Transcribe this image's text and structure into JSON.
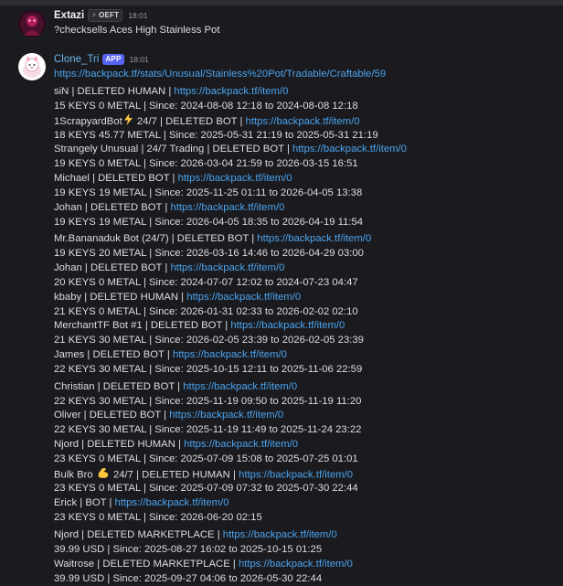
{
  "messages": [
    {
      "author": "Extazi",
      "guild_tag": "OEFT",
      "time": "18:01",
      "text": "?checksells Aces High Stainless Pot"
    },
    {
      "author": "Clone_Tri",
      "app_tag": "APP",
      "time": "18:01",
      "url": "https://backpack.tf/stats/Unusual/Stainless%20Pot/Tradable/Craftable/59",
      "listings": [
        {
          "user": "siN | DELETED HUMAN | ",
          "link": "https://backpack.tf/item/0",
          "detail": "15 KEYS 0 METAL | Since: 2024-08-08 12:18 to 2024-08-08 12:18"
        },
        {
          "user": "1ScrapyardBot",
          "emoji": "lightning",
          "user_suffix": " 24/7 | DELETED BOT | ",
          "link": "https://backpack.tf/item/0",
          "detail": "18 KEYS 45.77 METAL | Since: 2025-05-31 21:19 to 2025-05-31 21:19"
        },
        {
          "user": "Strangely Unusual | 24/7 Trading | DELETED BOT | ",
          "link": "https://backpack.tf/item/0",
          "detail": "19 KEYS 0 METAL | Since: 2026-03-04 21:59 to 2026-03-15 16:51"
        },
        {
          "user": "Michael | DELETED BOT | ",
          "link": "https://backpack.tf/item/0",
          "detail": "19 KEYS 19 METAL | Since: 2025-11-25 01:11 to 2026-04-05 13:38"
        },
        {
          "user": "Johan | DELETED BOT | ",
          "link": "https://backpack.tf/item/0",
          "detail": "19 KEYS 19 METAL | Since: 2026-04-05 18:35 to 2026-04-19 11:54"
        },
        {
          "user": "Mr.Bananaduk Bot (24/7) | DELETED BOT | ",
          "link": "https://backpack.tf/item/0",
          "detail": "19 KEYS 20 METAL | Since: 2026-03-16 14:46 to 2026-04-29 03:00"
        },
        {
          "user": "Johan | DELETED BOT | ",
          "link": "https://backpack.tf/item/0",
          "detail": "20 KEYS 0 METAL | Since: 2024-07-07 12:02 to 2024-07-23 04:47"
        },
        {
          "user": "kbaby | DELETED HUMAN | ",
          "link": "https://backpack.tf/item/0",
          "detail": "21 KEYS 0 METAL | Since: 2026-01-31 02:33 to 2026-02-02 02:10"
        },
        {
          "user": "MerchantTF Bot #1 | DELETED BOT | ",
          "link": "https://backpack.tf/item/0",
          "detail": "21 KEYS 30 METAL | Since: 2026-02-05 23:39 to 2026-02-05 23:39"
        },
        {
          "user": "James | DELETED BOT | ",
          "link": "https://backpack.tf/item/0",
          "detail": "22 KEYS 30 METAL | Since: 2025-10-15 12:11 to 2025-11-06 22:59"
        },
        {
          "user": "Christian | DELETED BOT | ",
          "link": "https://backpack.tf/item/0",
          "detail": "22 KEYS 30 METAL | Since: 2025-11-19 09:50 to 2025-11-19 11:20"
        },
        {
          "user": "Oliver | DELETED BOT | ",
          "link": "https://backpack.tf/item/0",
          "detail": "22 KEYS 30 METAL | Since: 2025-11-19 11:49 to 2025-11-24 23:22"
        },
        {
          "user": "Njord | DELETED HUMAN | ",
          "link": "https://backpack.tf/item/0",
          "detail": "23 KEYS 0 METAL | Since: 2025-07-09 15:08 to 2025-07-25 01:01"
        },
        {
          "user": "Bulk Bro ",
          "emoji": "muscle",
          "user_suffix": " 24/7 | DELETED HUMAN | ",
          "link": "https://backpack.tf/item/0",
          "detail": "23 KEYS 0 METAL | Since: 2025-07-09 07:32 to 2025-07-30 22:44"
        },
        {
          "user": "Erick | BOT | ",
          "link": "https://backpack.tf/item/0",
          "detail": "23 KEYS 0 METAL | Since: 2026-06-20 02:15"
        },
        {
          "user": "Njord | DELETED MARKETPLACE | ",
          "link": "https://backpack.tf/item/0",
          "detail": "39.99 USD | Since: 2025-08-27 16:02 to 2025-10-15 01:25"
        },
        {
          "user": "Waitrose | DELETED MARKETPLACE | ",
          "link": "https://backpack.tf/item/0",
          "detail": "39.99 USD | Since: 2025-09-27 04:06 to 2026-05-30 22:44"
        }
      ]
    }
  ],
  "colors": {
    "background": "#1b1b1f",
    "text": "#dbdee1",
    "link": "#4aa3ef",
    "bot_name": "#67b7e8",
    "app_badge": "#5865f2",
    "muted": "#949ba4"
  }
}
